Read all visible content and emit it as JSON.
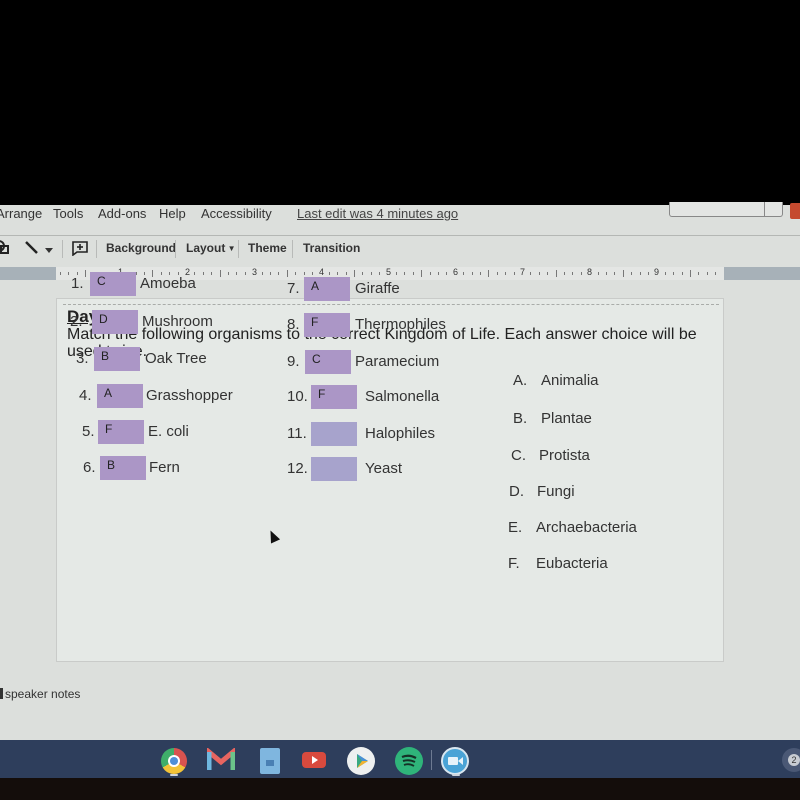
{
  "menubar": {
    "items": [
      "Arrange",
      "Tools",
      "Add-ons",
      "Help",
      "Accessibility"
    ],
    "last_edit": "Last edit was 4 minutes ago"
  },
  "toolbar": {
    "shape_icon": "shape-icon",
    "line_icon": "line-icon",
    "dropdown_icon": "chevron-down-icon",
    "comment_icon": "add-comment-icon",
    "background_label": "Background",
    "layout_label": "Layout",
    "theme_label": "Theme",
    "transition_label": "Transition"
  },
  "ruler": {
    "numbers": [
      "1",
      "2",
      "3",
      "4",
      "5",
      "6",
      "7",
      "8",
      "9"
    ]
  },
  "slide": {
    "title": "Day 3",
    "instructions": "Match the following organisms to the correct Kingdom of Life.  Each answer choice will be used twice.",
    "questions": [
      {
        "number": "1.",
        "answer": "C",
        "organism": "Amoeba"
      },
      {
        "number": "2.",
        "answer": "D",
        "organism": "Mushroom"
      },
      {
        "number": "3.",
        "answer": "B",
        "organism": "Oak Tree"
      },
      {
        "number": "4.",
        "answer": "A",
        "organism": "Grasshopper"
      },
      {
        "number": "5.",
        "answer": "F",
        "organism": "E. coli"
      },
      {
        "number": "6.",
        "answer": "B",
        "organism": "Fern"
      },
      {
        "number": "7.",
        "answer": "A",
        "organism": "Giraffe"
      },
      {
        "number": "8.",
        "answer": "F",
        "organism": "Thermophiles"
      },
      {
        "number": "9.",
        "answer": "C",
        "organism": "Paramecium"
      },
      {
        "number": "10.",
        "answer": "F",
        "organism": "Salmonella"
      },
      {
        "number": "11.",
        "answer": "",
        "organism": "Halophiles"
      },
      {
        "number": "12.",
        "answer": "",
        "organism": "Yeast"
      }
    ],
    "kingdoms": [
      {
        "letter": "A.",
        "name": "Animalia"
      },
      {
        "letter": "B.",
        "name": "Plantae"
      },
      {
        "letter": "C.",
        "name": "Protista"
      },
      {
        "letter": "D.",
        "name": "Fungi"
      },
      {
        "letter": "E.",
        "name": "Archaebacteria"
      },
      {
        "letter": "F.",
        "name": "Eubacteria"
      }
    ]
  },
  "notes": {
    "placeholder": "speaker notes"
  },
  "shelf": {
    "apps": [
      "chrome-icon",
      "gmail-icon",
      "docs-file-icon",
      "youtube-icon",
      "play-store-icon",
      "spotify-icon",
      "zoom-icon"
    ],
    "status_badge": "2"
  },
  "colors": {
    "answer_box": "#ab96c6",
    "shelf": "#2e3e5c",
    "background": "#dcdfdc"
  }
}
